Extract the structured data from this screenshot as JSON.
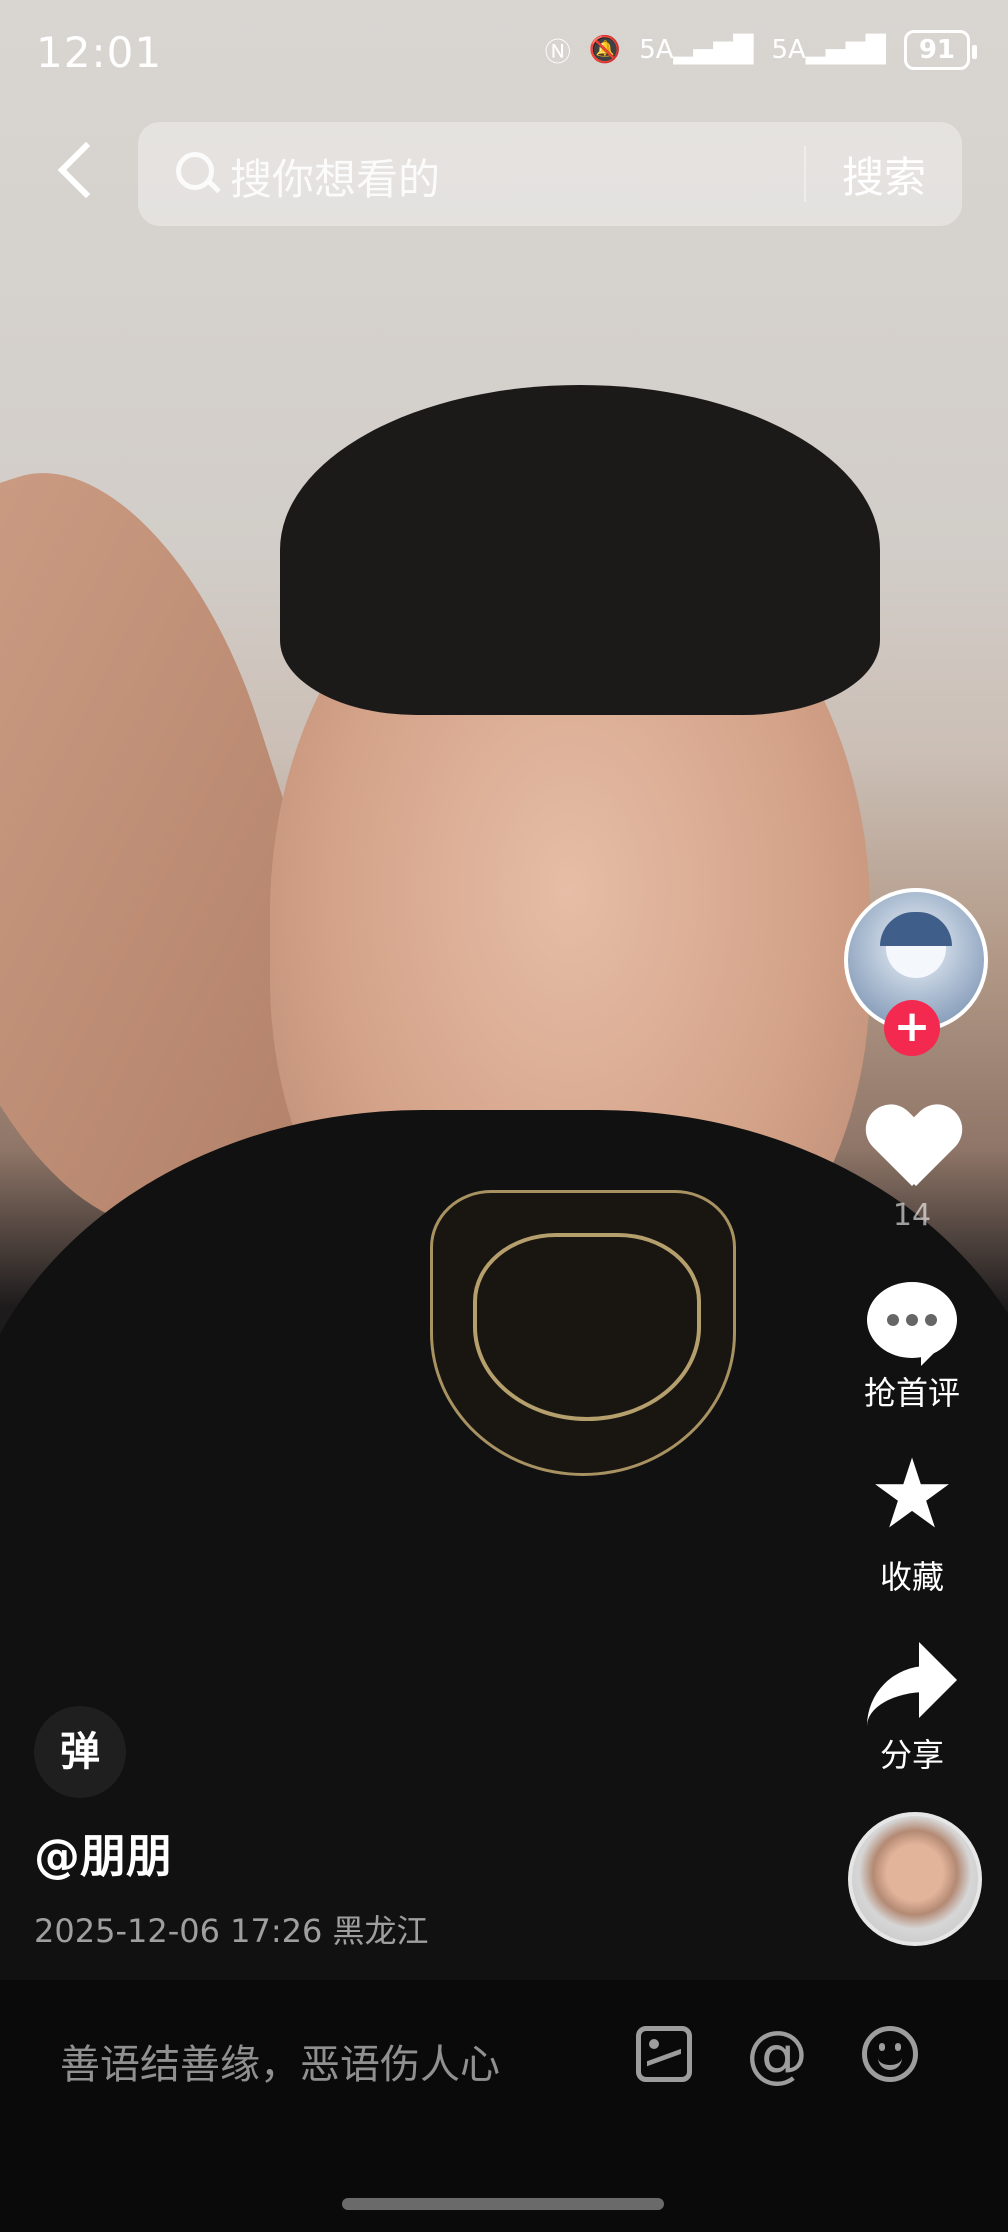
{
  "status_bar": {
    "time": "12:01",
    "signal1": "5A",
    "signal2": "5A",
    "battery": "91"
  },
  "search": {
    "placeholder": "搜你想看的",
    "button_label": "搜索"
  },
  "rail": {
    "follow_symbol": "+",
    "like_count": "14",
    "comment_label": "抢首评",
    "favorite_label": "收藏",
    "share_label": "分享"
  },
  "video_info": {
    "danmu_label": "弹",
    "author": "@朋朋",
    "meta": "2025-12-06 17:26 黑龙江"
  },
  "comment_bar": {
    "placeholder": "善语结善缘，恶语伤人心",
    "at_symbol": "@"
  },
  "icons": [
    "back-icon",
    "search-icon",
    "heart-icon",
    "comment-icon",
    "star-icon",
    "share-icon",
    "image-icon",
    "at-icon",
    "emoji-icon"
  ],
  "colors": {
    "follow_accent": "#f3294f"
  }
}
